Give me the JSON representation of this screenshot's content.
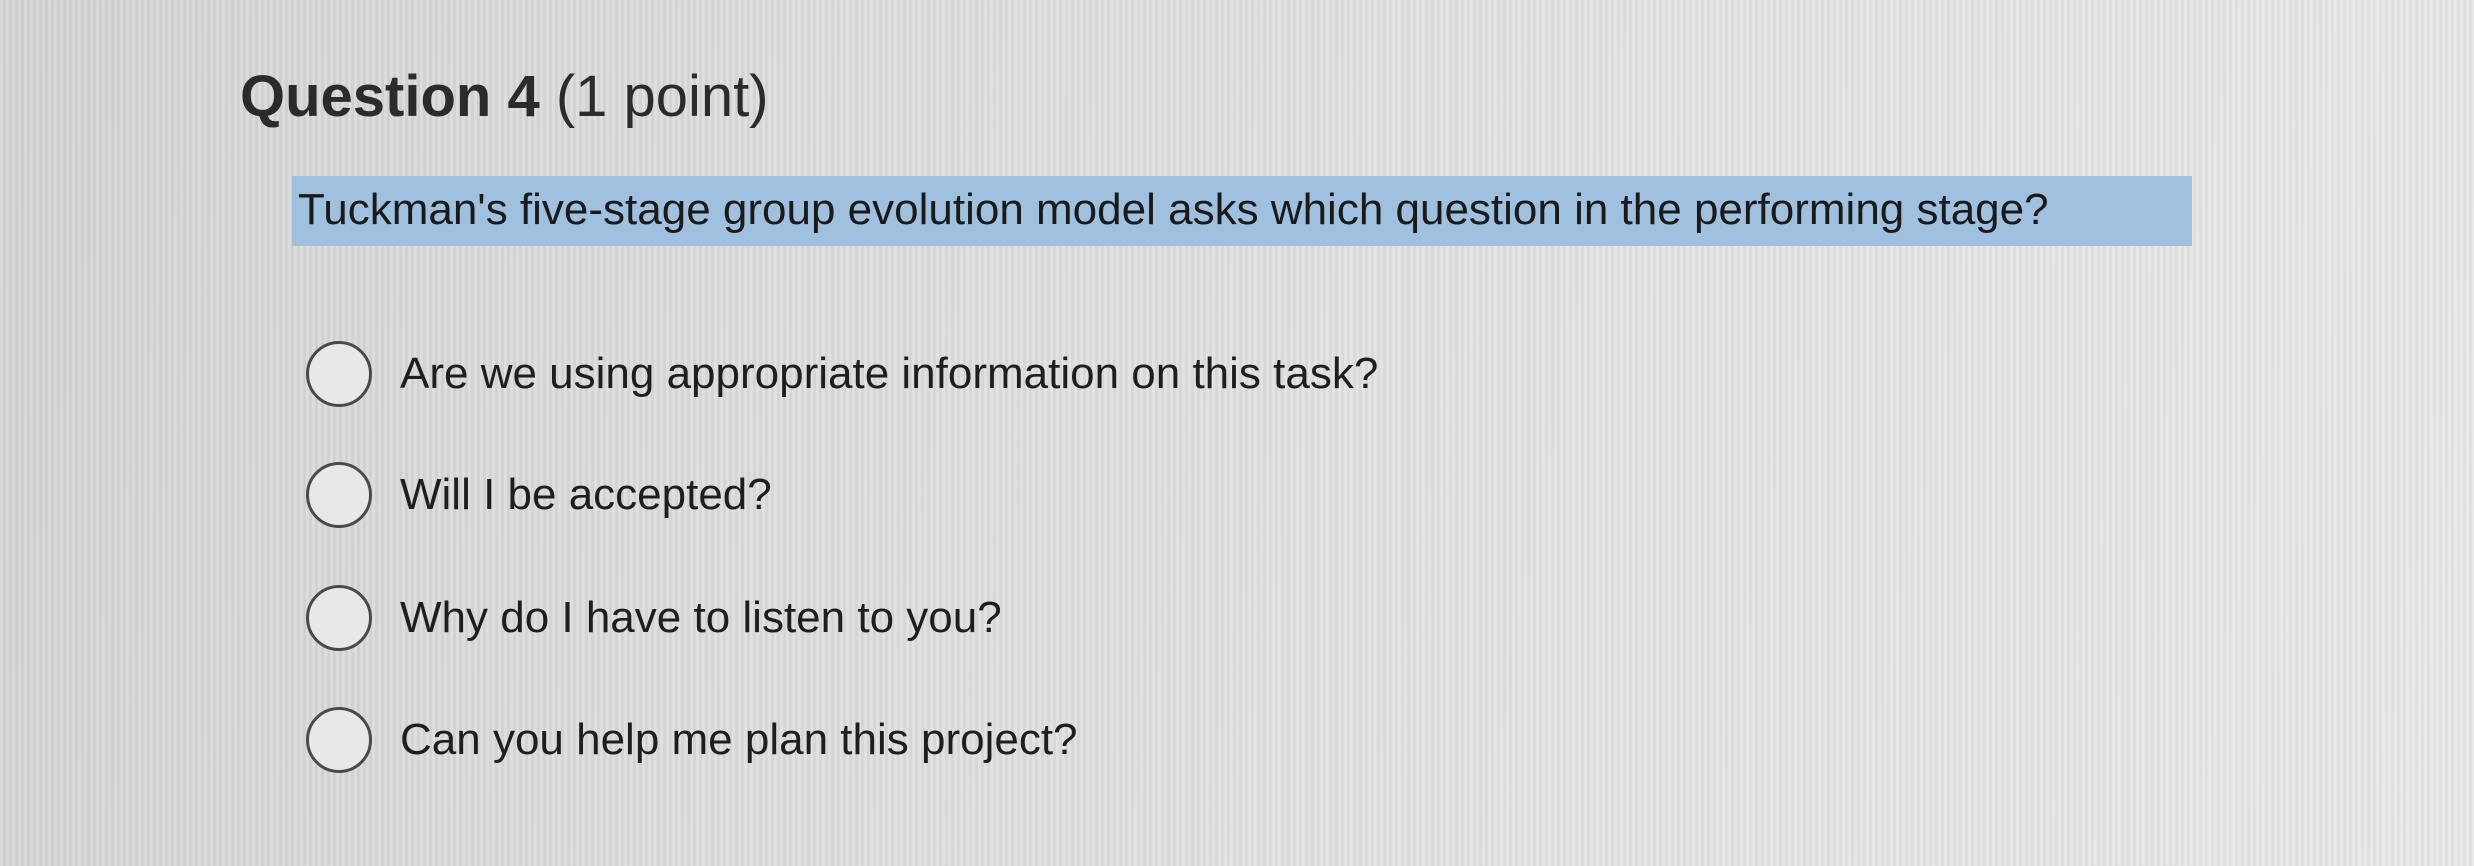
{
  "question": {
    "title": "Question 4",
    "points": "(1 point)",
    "prompt": "Tuckman's five-stage group evolution model asks which question in the performing stage?"
  },
  "options": [
    {
      "label": "Are we using appropriate information on this task?",
      "selected": false
    },
    {
      "label": "Will I be accepted?",
      "selected": false
    },
    {
      "label": "Why do I have to listen to you?",
      "selected": false
    },
    {
      "label": "Can you help me plan this project?",
      "selected": false
    }
  ],
  "colors": {
    "prompt_highlight": "#9fc0de",
    "text": "#1e1e1e",
    "background": "#dcdcdc"
  }
}
